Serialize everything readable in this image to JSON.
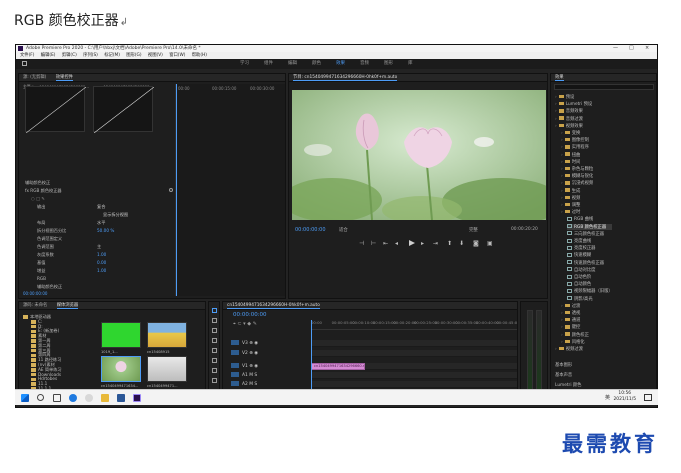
{
  "document": {
    "heading": "RGB 颜色校正器"
  },
  "window": {
    "title": "Adobe Premiere Pro 2020 - C:\\用户\\hbxj\\文档\\Adobe\\Premiere Pro\\14.0\\未命名 *",
    "controls": [
      "—",
      "□",
      "×"
    ]
  },
  "menubar": [
    "文件(F)",
    "编辑(E)",
    "剪辑(C)",
    "序列(S)",
    "标记(M)",
    "图形(G)",
    "视图(V)",
    "窗口(W)",
    "帮助(H)"
  ],
  "workspaces": [
    "学习",
    "组件",
    "编辑",
    "颜色",
    "效果",
    "音频",
    "图形",
    "库"
  ],
  "active_workspace": "效果",
  "effect_controls": {
    "tabs": [
      "源: (无剪辑)",
      "效果控件"
    ],
    "master": "主要 * cn1540499471634296660...",
    "clip": "cn1540499471634296660...",
    "timecodes": [
      "00:00",
      "00:00:15:00",
      "00:00:30:00"
    ],
    "rows": [
      {
        "label": "辅助颜色校正",
        "value": ""
      },
      {
        "label": "fx  RGB 颜色校正器",
        "value": ""
      },
      {
        "label": "输出",
        "value": "复合"
      },
      {
        "label": "",
        "value": "显示拆分视图"
      },
      {
        "label": "布局",
        "value": "水平"
      },
      {
        "label": "拆分视图百分比",
        "value": "50.00 %"
      },
      {
        "label": "色调范围定义",
        "value": ""
      },
      {
        "label": "色调范围",
        "value": "主"
      },
      {
        "label": "灰度系数",
        "value": "1.00"
      },
      {
        "label": "基值",
        "value": "0.00"
      },
      {
        "label": "增益",
        "value": "1.00"
      },
      {
        "label": "RGB",
        "value": ""
      },
      {
        "label": "辅助颜色校正",
        "value": ""
      }
    ],
    "current_time": "00:00:00:00"
  },
  "program_monitor": {
    "tab": "节目: cn1540499471634296660H-0hk0f+m.auto",
    "current_time": "00:00:00:00",
    "fit": "适合",
    "quality": "完整",
    "duration": "00:00:20:20"
  },
  "effects_panel": {
    "title": "效果",
    "items": [
      {
        "label": "预设",
        "type": "folder",
        "depth": 0
      },
      {
        "label": "Lumetri 预设",
        "type": "folder",
        "depth": 0
      },
      {
        "label": "音频效果",
        "type": "folder",
        "depth": 0
      },
      {
        "label": "音频过渡",
        "type": "folder",
        "depth": 0
      },
      {
        "label": "视频效果",
        "type": "folder",
        "depth": 0
      },
      {
        "label": "变换",
        "type": "folder",
        "depth": 1
      },
      {
        "label": "图像控制",
        "type": "folder",
        "depth": 1
      },
      {
        "label": "实用程序",
        "type": "folder",
        "depth": 1
      },
      {
        "label": "扭曲",
        "type": "folder",
        "depth": 1
      },
      {
        "label": "时间",
        "type": "folder",
        "depth": 1
      },
      {
        "label": "杂色与颗粒",
        "type": "folder",
        "depth": 1
      },
      {
        "label": "模糊与锐化",
        "type": "folder",
        "depth": 1
      },
      {
        "label": "沉浸式视频",
        "type": "folder",
        "depth": 1
      },
      {
        "label": "生成",
        "type": "folder",
        "depth": 1
      },
      {
        "label": "视频",
        "type": "folder",
        "depth": 1
      },
      {
        "label": "调整",
        "type": "folder",
        "depth": 1
      },
      {
        "label": "过时",
        "type": "folder",
        "depth": 1
      },
      {
        "label": "RGB 曲线",
        "type": "fx",
        "depth": 2
      },
      {
        "label": "RGB 颜色校正器",
        "type": "fx",
        "depth": 2,
        "highlight": true
      },
      {
        "label": "三向颜色校正器",
        "type": "fx",
        "depth": 2
      },
      {
        "label": "亮度曲线",
        "type": "fx",
        "depth": 2
      },
      {
        "label": "亮度校正器",
        "type": "fx",
        "depth": 2
      },
      {
        "label": "快速模糊",
        "type": "fx",
        "depth": 2
      },
      {
        "label": "快速颜色校正器",
        "type": "fx",
        "depth": 2
      },
      {
        "label": "自动对比度",
        "type": "fx",
        "depth": 2
      },
      {
        "label": "自动色阶",
        "type": "fx",
        "depth": 2
      },
      {
        "label": "自动颜色",
        "type": "fx",
        "depth": 2
      },
      {
        "label": "视频限幅器（旧版）",
        "type": "fx",
        "depth": 2
      },
      {
        "label": "阴影/高光",
        "type": "fx",
        "depth": 2
      },
      {
        "label": "过渡",
        "type": "folder",
        "depth": 1
      },
      {
        "label": "透视",
        "type": "folder",
        "depth": 1
      },
      {
        "label": "通道",
        "type": "folder",
        "depth": 1
      },
      {
        "label": "键控",
        "type": "folder",
        "depth": 1
      },
      {
        "label": "颜色校正",
        "type": "folder",
        "depth": 1
      },
      {
        "label": "风格化",
        "type": "folder",
        "depth": 1
      },
      {
        "label": "视频过渡",
        "type": "folder",
        "depth": 0
      }
    ],
    "sections": [
      "基本图形",
      "基本声音",
      "Lumetri 颜色"
    ]
  },
  "project_panel": {
    "tabs": [
      "源码: 未命名",
      "媒体浏览器"
    ],
    "folders": [
      "本地驱动器",
      "C:",
      "D:",
      "E: (新加卷)",
      "素材",
      "第一周",
      "第二周",
      "第三周",
      "第四周",
      "11 路径练习",
      "(nv)素材",
      "AE 简单练习",
      "Downloads",
      "Hdrtobes",
      "11.1",
      "11.1.1",
      "图片"
    ],
    "thumbs": [
      {
        "label": "1019_1...",
        "color": "#2fd62f"
      },
      {
        "label": "cn15408915",
        "color": "#e8c84a"
      },
      {
        "label": "cn1540499471634...",
        "color": "#8fbf70"
      },
      {
        "label": "cn1540499471...",
        "color": "#dcdcdc"
      },
      {
        "label": "cn1540499471...",
        "color": "#c9a06a"
      }
    ]
  },
  "timeline": {
    "tab": "cn1540499471634296660H-0hk0f+m.auto",
    "current_time": "00:00:00:00",
    "ruler": [
      "00:00",
      "00:00:05:00",
      "00:00:10:00",
      "00:00:15:00",
      "00:00:20:00",
      "00:00:25:00",
      "00:00:30:00",
      "00:00:35:00",
      "00:00:40:00",
      "00:00:45:00"
    ],
    "tracks": [
      "V3",
      "V2",
      "V1",
      "A1",
      "A2",
      "A3",
      "主声道"
    ],
    "master_value": "0.0",
    "clip_label": "cn1540499471634296660.mauto"
  },
  "taskbar": {
    "lang": "英",
    "time": "10:56",
    "date": "2021/11/5"
  },
  "watermark": "最需教育",
  "colors": {
    "accent": "#4d9cf6",
    "clip": "#d48ad3",
    "highlight": "#3a3a3a"
  }
}
